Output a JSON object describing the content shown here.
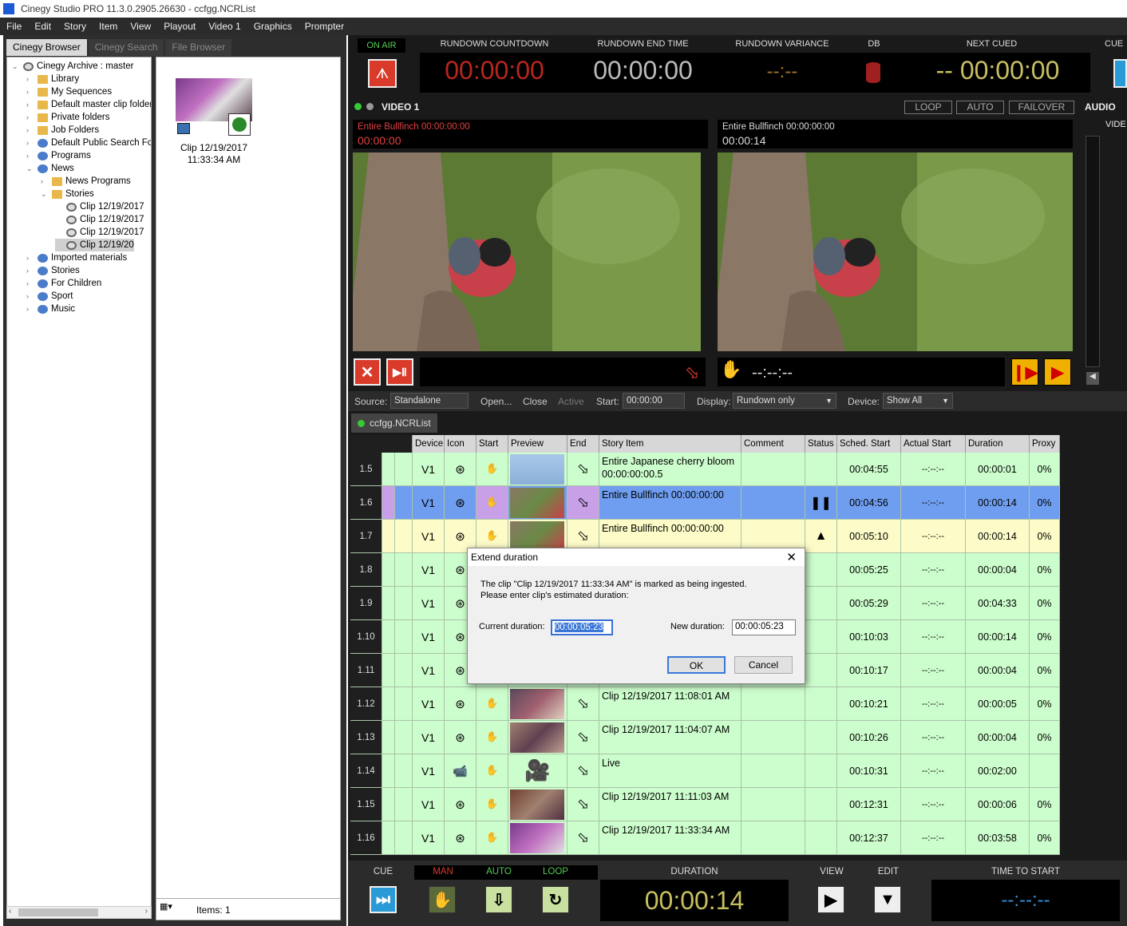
{
  "window": {
    "title": "Cinegy Studio PRO 11.3.0.2905.26630 - ccfgg.NCRList"
  },
  "menu": [
    "File",
    "Edit",
    "Story",
    "Item",
    "View",
    "Playout",
    "Video 1",
    "Graphics",
    "Prompter"
  ],
  "browser_tabs": [
    {
      "label": "Cinegy Browser",
      "active": true
    },
    {
      "label": "Cinegy Search",
      "active": false
    },
    {
      "label": "File Browser",
      "active": false
    }
  ],
  "tree": [
    {
      "label": "Cinegy Archive : master",
      "level": 0,
      "icon": "archive-icon",
      "expanded": true
    },
    {
      "label": "Library",
      "level": 1,
      "icon": "library-icon"
    },
    {
      "label": "My Sequences",
      "level": 1,
      "icon": "folder-icon"
    },
    {
      "label": "Default master clip folder",
      "level": 1,
      "icon": "folder-icon"
    },
    {
      "label": "Private folders",
      "level": 1,
      "icon": "folder-icon"
    },
    {
      "label": "Job Folders",
      "level": 1,
      "icon": "job-folder-icon"
    },
    {
      "label": "Default Public Search Fol",
      "level": 1,
      "icon": "search-folder-icon"
    },
    {
      "label": "Programs",
      "level": 1,
      "icon": "program-icon"
    },
    {
      "label": "News",
      "level": 1,
      "icon": "program-icon",
      "expanded": true
    },
    {
      "label": "News Programs",
      "level": 2,
      "icon": "folder-icon"
    },
    {
      "label": "Stories",
      "level": 2,
      "icon": "folder-icon",
      "expanded": true
    },
    {
      "label": "Clip 12/19/2017",
      "level": 3,
      "icon": "reel-icon"
    },
    {
      "label": "Clip 12/19/2017",
      "level": 3,
      "icon": "reel-icon"
    },
    {
      "label": "Clip 12/19/2017",
      "level": 3,
      "icon": "reel-icon"
    },
    {
      "label": "Clip 12/19/20",
      "level": 3,
      "icon": "reel-icon",
      "selected": true
    },
    {
      "label": "Imported materials",
      "level": 1,
      "icon": "program-icon"
    },
    {
      "label": "Stories",
      "level": 1,
      "icon": "program-icon"
    },
    {
      "label": "For Children",
      "level": 1,
      "icon": "program-icon"
    },
    {
      "label": "Sport",
      "level": 1,
      "icon": "program-icon"
    },
    {
      "label": "Music",
      "level": 1,
      "icon": "program-icon"
    }
  ],
  "thumb_item": {
    "caption": "Clip 12/19/2017 11:33:34 AM"
  },
  "left_status": {
    "items": "Items: 1"
  },
  "header": {
    "on_air": "ON AIR",
    "rundown_countdown": {
      "label": "RUNDOWN COUNTDOWN",
      "value": "00:00:00"
    },
    "rundown_end_time": {
      "label": "RUNDOWN END TIME",
      "value": "00:00:00"
    },
    "rundown_variance": {
      "label": "RUNDOWN VARIANCE",
      "value": "--:--"
    },
    "db": {
      "label": "DB"
    },
    "next_cued": {
      "label": "NEXT CUED",
      "value": "-- 00:00:00"
    },
    "cue": "CUE"
  },
  "video": {
    "channel": "VIDEO 1",
    "buttons": [
      "LOOP",
      "AUTO",
      "FAILOVER"
    ],
    "audio": "AUDIO",
    "audio_sub": "VIDE",
    "left": {
      "clip": "Entire Bullfinch 00:00:00:00",
      "tc": "00:00:00"
    },
    "right": {
      "clip": "Entire Bullfinch 00:00:00:00",
      "tc": "00:00:14"
    },
    "remaining": "--:--:--"
  },
  "source_bar": {
    "source_label": "Source:",
    "source_value": "Standalone",
    "open": "Open...",
    "close": "Close",
    "active": "Active",
    "start_label": "Start:",
    "start_value": "00:00:00",
    "display_label": "Display:",
    "display_value": "Rundown only",
    "device_label": "Device:",
    "device_value": "Show All"
  },
  "list_tab": "ccfgg.NCRList",
  "columns": [
    "Device",
    "Icon",
    "Start",
    "Preview",
    "End",
    "Story Item",
    "Comment",
    "Status",
    "Sched. Start",
    "Actual Start",
    "Duration",
    "Proxy"
  ],
  "rows": [
    {
      "num": "1.5",
      "device": "V1",
      "story": "Entire Japanese cherry bloom 00:00:00:00.5",
      "status": "",
      "sched": "00:04:55",
      "actual": "--:--:--",
      "duration": "00:00:01",
      "proxy": "0%",
      "state": "normal"
    },
    {
      "num": "1.6",
      "device": "V1",
      "story": "Entire Bullfinch 00:00:00:00",
      "status": "pause",
      "sched": "00:04:56",
      "actual": "--:--:--",
      "duration": "00:00:14",
      "proxy": "0%",
      "state": "onair"
    },
    {
      "num": "1.7",
      "device": "V1",
      "story": "Entire Bullfinch 00:00:00:00",
      "status": "cued",
      "sched": "00:05:10",
      "actual": "--:--:--",
      "duration": "00:00:14",
      "proxy": "0%",
      "state": "next"
    },
    {
      "num": "1.8",
      "device": "V1",
      "story": "",
      "status": "",
      "sched": "00:05:25",
      "actual": "--:--:--",
      "duration": "00:00:04",
      "proxy": "0%",
      "state": "normal"
    },
    {
      "num": "1.9",
      "device": "V1",
      "story": "",
      "status": "",
      "sched": "00:05:29",
      "actual": "--:--:--",
      "duration": "00:04:33",
      "proxy": "0%",
      "state": "normal"
    },
    {
      "num": "1.10",
      "device": "V1",
      "story": "",
      "status": "",
      "sched": "00:10:03",
      "actual": "--:--:--",
      "duration": "00:00:14",
      "proxy": "0%",
      "state": "normal"
    },
    {
      "num": "1.11",
      "device": "V1",
      "story": "",
      "status": "",
      "sched": "00:10:17",
      "actual": "--:--:--",
      "duration": "00:00:04",
      "proxy": "0%",
      "state": "normal"
    },
    {
      "num": "1.12",
      "device": "V1",
      "story": "Clip 12/19/2017 11:08:01 AM",
      "status": "",
      "sched": "00:10:21",
      "actual": "--:--:--",
      "duration": "00:00:05",
      "proxy": "0%",
      "state": "normal"
    },
    {
      "num": "1.13",
      "device": "V1",
      "story": "Clip 12/19/2017 11:04:07 AM",
      "status": "",
      "sched": "00:10:26",
      "actual": "--:--:--",
      "duration": "00:00:04",
      "proxy": "0%",
      "state": "normal"
    },
    {
      "num": "1.14",
      "device": "V1",
      "story": "Live",
      "status": "",
      "sched": "00:10:31",
      "actual": "--:--:--",
      "duration": "00:02:00",
      "proxy": "",
      "state": "normal",
      "live": true
    },
    {
      "num": "1.15",
      "device": "V1",
      "story": "Clip 12/19/2017 11:11:03 AM",
      "status": "",
      "sched": "00:12:31",
      "actual": "--:--:--",
      "duration": "00:00:06",
      "proxy": "0%",
      "state": "normal"
    },
    {
      "num": "1.16",
      "device": "V1",
      "story": "Clip 12/19/2017 11:33:34 AM",
      "status": "",
      "sched": "00:12:37",
      "actual": "--:--:--",
      "duration": "00:03:58",
      "proxy": "0%",
      "state": "normal"
    }
  ],
  "dialog": {
    "title": "Extend duration",
    "message": "The clip \"Clip 12/19/2017 11:33:34 AM\" is marked as being ingested. Please enter clip's estimated duration:",
    "current_label": "Current duration:",
    "current_value": "00:00:05:23",
    "new_label": "New duration:",
    "new_value": "00:00:05:23",
    "ok": "OK",
    "cancel": "Cancel"
  },
  "bottom": {
    "cue": "CUE",
    "man": "MAN",
    "auto": "AUTO",
    "loop": "LOOP",
    "duration_label": "DURATION",
    "duration_value": "00:00:14",
    "view": "VIEW",
    "edit": "EDIT",
    "time_to_start_label": "TIME TO START",
    "time_to_start_value": "--:--:--"
  },
  "colors": {
    "row_green": "#ccfdcc",
    "row_onair": "#6f9ef0",
    "row_next": "#fdfcc8",
    "accent_red": "#d93a2a",
    "tc_olive": "#c8c060"
  }
}
